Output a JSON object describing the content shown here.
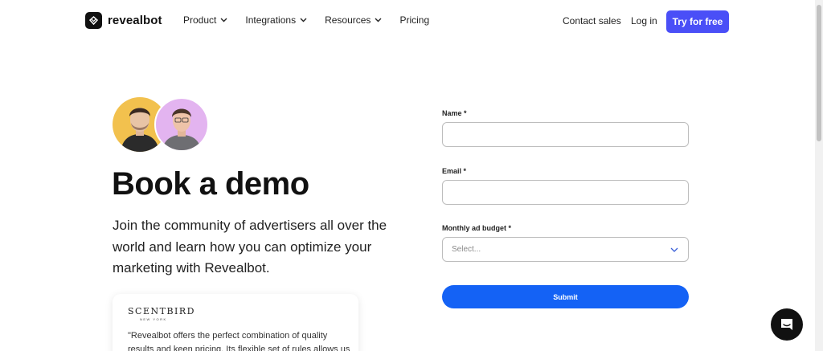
{
  "brand": {
    "name": "revealbot"
  },
  "nav": {
    "items": [
      {
        "label": "Product",
        "has_dropdown": true
      },
      {
        "label": "Integrations",
        "has_dropdown": true
      },
      {
        "label": "Resources",
        "has_dropdown": true
      },
      {
        "label": "Pricing",
        "has_dropdown": false
      }
    ],
    "contact_sales": "Contact sales",
    "login": "Log in",
    "cta": "Try for free",
    "cta_color": "#4a4ff7"
  },
  "hero": {
    "title": "Book a demo",
    "description": "Join the community of advertisers all over the world and learn how you can optimize your marketing with Revealbot."
  },
  "testimonial": {
    "brand": "SCENTBIRD",
    "brand_sub": "NEW YORK",
    "quote": "\"Revealbot offers the perfect combination of quality results and keen pricing. Its flexible set of rules allows us"
  },
  "form": {
    "name_label": "Name *",
    "email_label": "Email *",
    "budget_label": "Monthly ad budget *",
    "budget_placeholder": "Select...",
    "submit_label": "Submit",
    "submit_color": "#1462f5"
  },
  "chat": {
    "icon": "chat-icon"
  }
}
